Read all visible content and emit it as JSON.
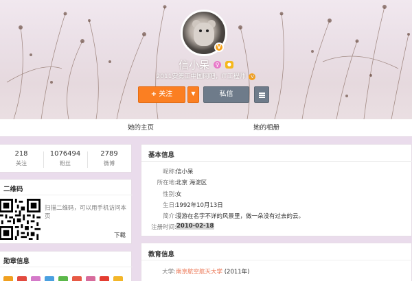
{
  "cover": {
    "name": "信小呆",
    "verification": "2011安第工中国网吧，IT工程师",
    "follow_label": "关注",
    "message_label": "私信"
  },
  "tabs": {
    "home": "她的主页",
    "album": "她的相册"
  },
  "stats": [
    {
      "value": "218",
      "label": "关注"
    },
    {
      "value": "1076494",
      "label": "粉丝"
    },
    {
      "value": "2789",
      "label": "微博"
    }
  ],
  "qr": {
    "title": "二维码",
    "text": "扫描二维码，可以用手机访问本页",
    "download": "下载"
  },
  "medals": {
    "title": "勋章信息"
  },
  "basic": {
    "title": "基本信息",
    "rows": [
      {
        "k": "昵称:",
        "v": "信小呆"
      },
      {
        "k": "所在地:",
        "v": "北京 海淀区"
      },
      {
        "k": "性别:",
        "v": "女"
      },
      {
        "k": "生日:",
        "v": "1992年10月13日"
      },
      {
        "k": "简介:",
        "v": "漫游在名字不详的风景里，做一朵没有过去的云。"
      },
      {
        "k": "注册时间:",
        "v": "2010-02-18"
      }
    ]
  },
  "education": {
    "title": "教育信息",
    "label": "大学:",
    "school": "南京航空航天大学",
    "year": "(2011年)"
  },
  "colors": {
    "accent_orange": "#fb7f22",
    "button_gray": "#6e7b8a",
    "page_bg": "#eadcec",
    "link_orange": "#eb7350"
  },
  "icons": [
    "avatar",
    "verified-v-icon",
    "female-icon",
    "level-icon",
    "plus-icon",
    "chevron-down-icon",
    "menu-icon",
    "qr-code",
    "medal-icons"
  ]
}
